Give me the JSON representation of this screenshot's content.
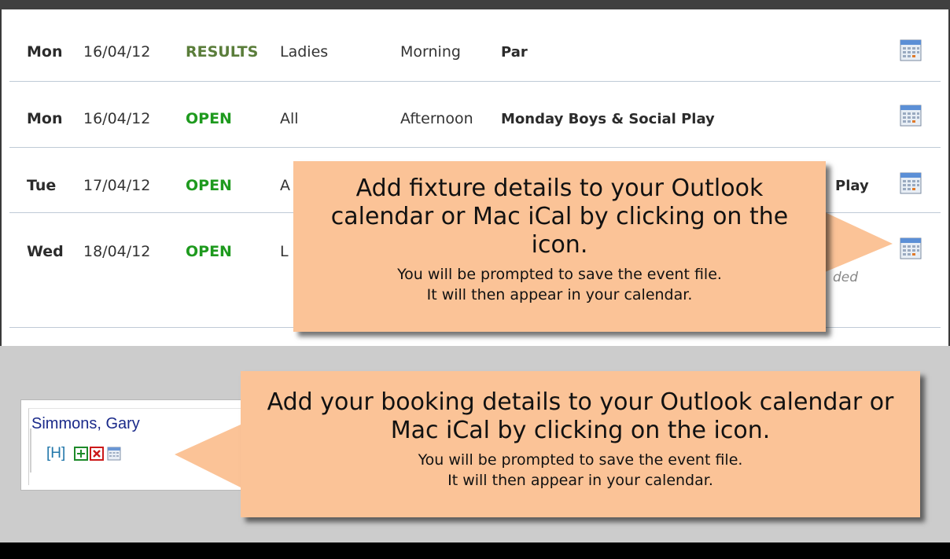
{
  "fixtures": [
    {
      "day": "Mon",
      "date": "16/04/12",
      "status": "RESULTS",
      "group": "Ladies",
      "session": "Morning",
      "competition": "Par",
      "note": ""
    },
    {
      "day": "Mon",
      "date": "16/04/12",
      "status": "OPEN",
      "group": "All",
      "session": "Afternoon",
      "competition": "Monday Boys & Social Play",
      "note": ""
    },
    {
      "day": "Tue",
      "date": "17/04/12",
      "status": "OPEN",
      "group": "A",
      "session": "",
      "competition": "Play",
      "note": ""
    },
    {
      "day": "Wed",
      "date": "18/04/12",
      "status": "OPEN",
      "group": "L",
      "session": "",
      "competition": "",
      "note": "ded"
    }
  ],
  "booking": {
    "player_name": "Simmons, Gary",
    "handicap_link": "[H]"
  },
  "callouts": {
    "fixture": {
      "heading": "Add fixture details to your Outlook calendar or Mac iCal by clicking on the icon.",
      "line1": "You will be prompted to save the event file.",
      "line2": "It will then appear in your calendar."
    },
    "booking": {
      "heading": "Add your booking details to your Outlook calendar or Mac iCal by clicking on the icon.",
      "line1": "You will be prompted to save the event file.",
      "line2": "It will then appear in your calendar."
    }
  },
  "colors": {
    "callout_bg": "#fbc397",
    "status_open": "#1e9a1e",
    "status_results": "#5a7d3a",
    "player_link": "#1a2a8a"
  },
  "icons": {
    "calendar": "calendar-icon",
    "add": "plus-icon",
    "remove": "close-icon"
  }
}
